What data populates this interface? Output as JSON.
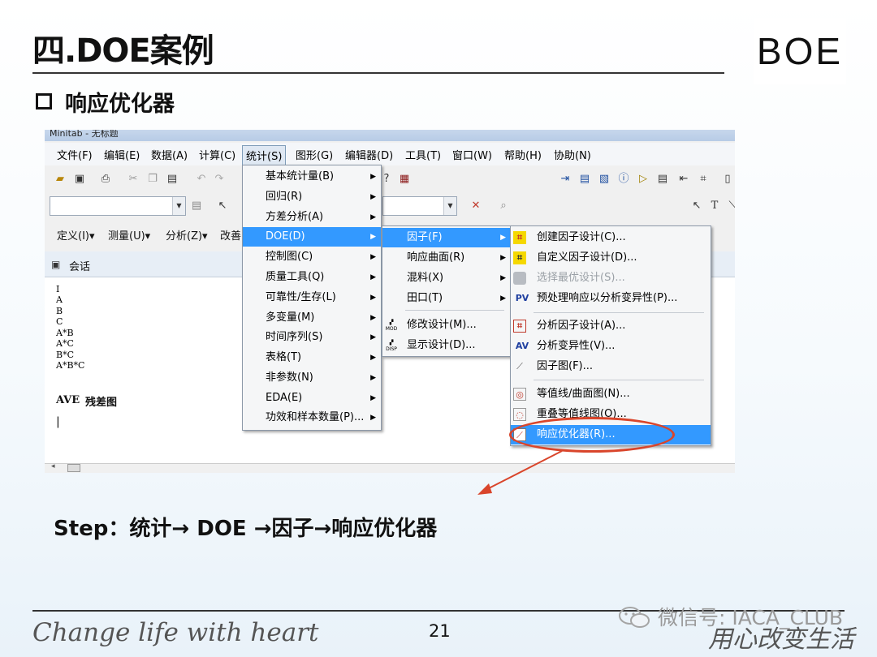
{
  "slide": {
    "title": "四.DOE案例",
    "subtitle": "响应优化器",
    "logo": "BOE",
    "step_text": "Step：统计→ DOE →因子→响应优化器",
    "tagline": "Change life with heart",
    "page_number": "21",
    "watermark": "微信号: IACA_CLUB",
    "signature": "用心改变生活"
  },
  "window": {
    "title": "Minitab - 无标题"
  },
  "menubar": {
    "items": [
      {
        "label": "文件(F)"
      },
      {
        "label": "编辑(E)"
      },
      {
        "label": "数据(A)"
      },
      {
        "label": "计算(C)"
      },
      {
        "label": "统计(S)"
      },
      {
        "label": "图形(G)"
      },
      {
        "label": "编辑器(D)"
      },
      {
        "label": "工具(T)"
      },
      {
        "label": "窗口(W)"
      },
      {
        "label": "帮助(H)"
      },
      {
        "label": "协助(N)"
      }
    ]
  },
  "toolbar3": {
    "items": [
      {
        "label": "定义(I)▾"
      },
      {
        "label": "测量(U)▾"
      },
      {
        "label": "分析(Z)▾"
      },
      {
        "label": "改善"
      }
    ]
  },
  "session": {
    "title": "会话",
    "lines": [
      "I",
      "A",
      "B",
      "C",
      "A*B",
      "A*C",
      "B*C",
      "A*B*C"
    ],
    "ave_label": "AVE",
    "residual_label": "残差图",
    "cursor": "|"
  },
  "stat_menu": {
    "items": [
      {
        "label": "基本统计量(B)"
      },
      {
        "label": "回归(R)"
      },
      {
        "label": "方差分析(A)"
      },
      {
        "label": "DOE(D)"
      },
      {
        "label": "控制图(C)"
      },
      {
        "label": "质量工具(Q)"
      },
      {
        "label": "可靠性/生存(L)"
      },
      {
        "label": "多变量(M)"
      },
      {
        "label": "时间序列(S)"
      },
      {
        "label": "表格(T)"
      },
      {
        "label": "非参数(N)"
      },
      {
        "label": "EDA(E)"
      },
      {
        "label": "功效和样本数量(P)..."
      }
    ]
  },
  "doe_menu": {
    "items": [
      {
        "label": "因子(F)"
      },
      {
        "label": "响应曲面(R)"
      },
      {
        "label": "混料(X)"
      },
      {
        "label": "田口(T)"
      },
      {
        "label": "修改设计(M)..."
      },
      {
        "label": "显示设计(D)..."
      }
    ],
    "icon_mod": "MOD",
    "icon_disp": "DISP"
  },
  "factor_menu": {
    "items": [
      {
        "label": "创建因子设计(C)..."
      },
      {
        "label": "自定义因子设计(D)..."
      },
      {
        "label": "选择最优设计(S)..."
      },
      {
        "label": "预处理响应以分析变异性(P)..."
      },
      {
        "label": "分析因子设计(A)..."
      },
      {
        "label": "分析变异性(V)..."
      },
      {
        "label": "因子图(F)..."
      },
      {
        "label": "等值线/曲面图(N)..."
      },
      {
        "label": "重叠等值线图(O)..."
      },
      {
        "label": "响应优化器(R)..."
      }
    ],
    "icon_pv": "PV",
    "icon_av": "AV"
  },
  "colors": {
    "highlight": "#3399ff",
    "annotation": "#d9452b"
  }
}
